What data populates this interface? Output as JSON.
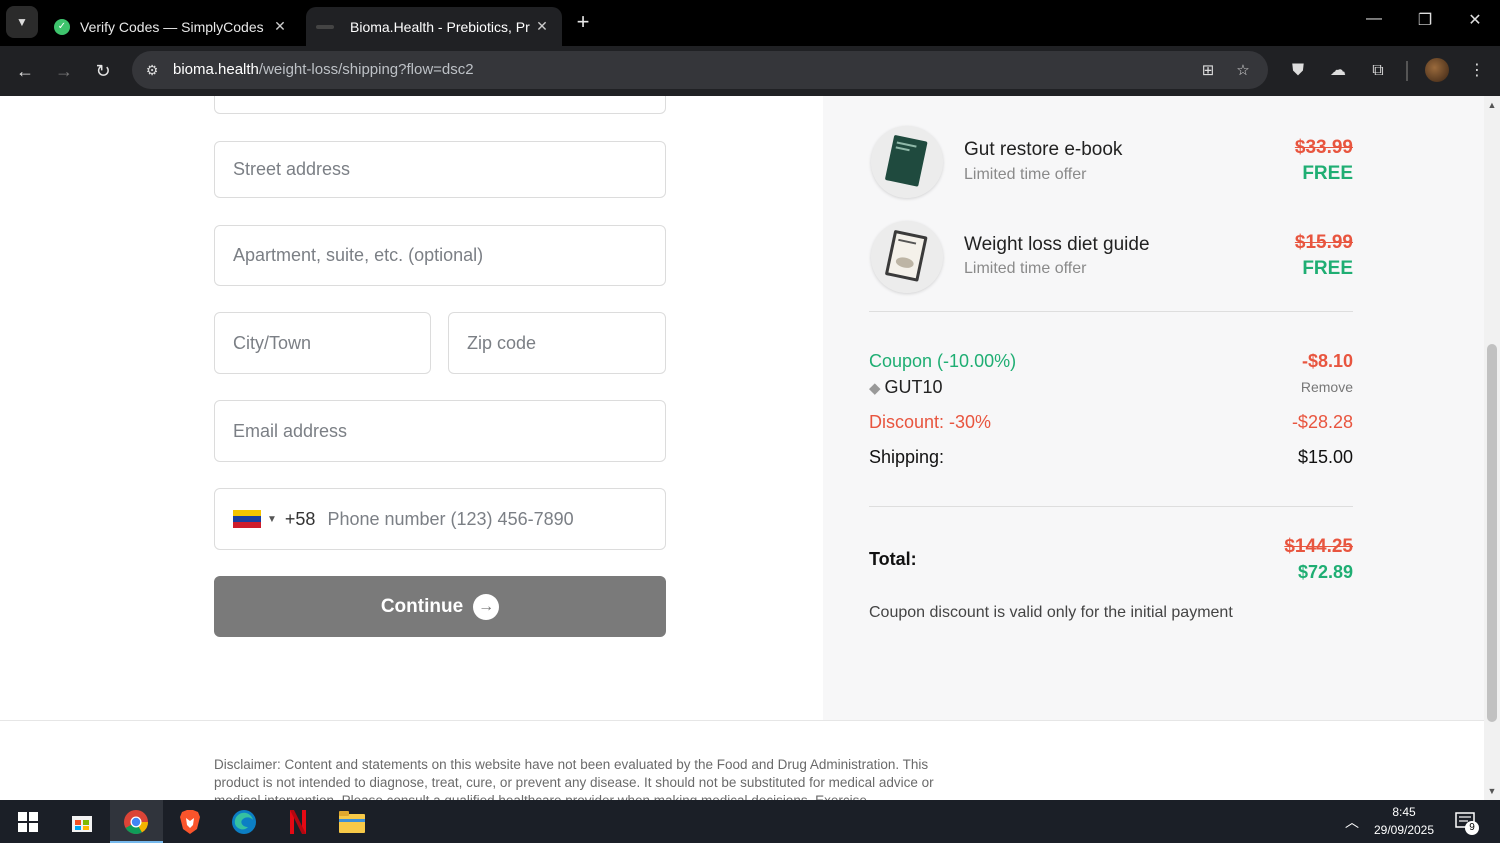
{
  "browser": {
    "tabs": [
      {
        "title": "Verify Codes — SimplyCodes",
        "active": false
      },
      {
        "title": "Bioma.Health - Prebiotics, Probi",
        "active": true
      }
    ],
    "url_host": "bioma.health",
    "url_path": "/weight-loss/shipping?flow=dsc2"
  },
  "form": {
    "street_placeholder": "Street address",
    "apartment_placeholder": "Apartment, suite, etc. (optional)",
    "city_placeholder": "City/Town",
    "zip_placeholder": "Zip code",
    "email_placeholder": "Email address",
    "phone_code": "+58",
    "phone_placeholder": "Phone number (123) 456-7890",
    "flag_colors": [
      "#f4c400",
      "#1a3e9e",
      "#cf1c2b"
    ],
    "continue_label": "Continue"
  },
  "summary": {
    "products": [
      {
        "name": "Gut restore e-book",
        "subtitle": "Limited time offer",
        "old_price": "$33.99",
        "price": "FREE"
      },
      {
        "name": "Weight loss diet guide",
        "subtitle": "Limited time offer",
        "old_price": "$15.99",
        "price": "FREE"
      }
    ],
    "coupon_label": "Coupon (-10.00%)",
    "coupon_amount": "-$8.10",
    "coupon_code": "GUT10",
    "remove_label": "Remove",
    "discount_label": "Discount: -30%",
    "discount_amount": "-$28.28",
    "shipping_label": "Shipping:",
    "shipping_amount": "$15.00",
    "total_label": "Total:",
    "total_old": "$144.25",
    "total_new": "$72.89",
    "note": "Coupon discount is valid only for the initial payment"
  },
  "footer": {
    "disclaimer": "Disclaimer: Content and statements on this website have not been evaluated by the Food and Drug Administration. This product is not intended to diagnose, treat, cure, or prevent any disease. It should not be substituted for medical advice or medical intervention. Please consult a qualified healthcare provider when making medical decisions. Exercise"
  },
  "colors": {
    "green": "#1fae73",
    "red": "#e8553f",
    "button_gray": "#7a7a7a"
  },
  "taskbar": {
    "time": "8:45",
    "date": "29/09/2025",
    "notification_count": "9"
  }
}
